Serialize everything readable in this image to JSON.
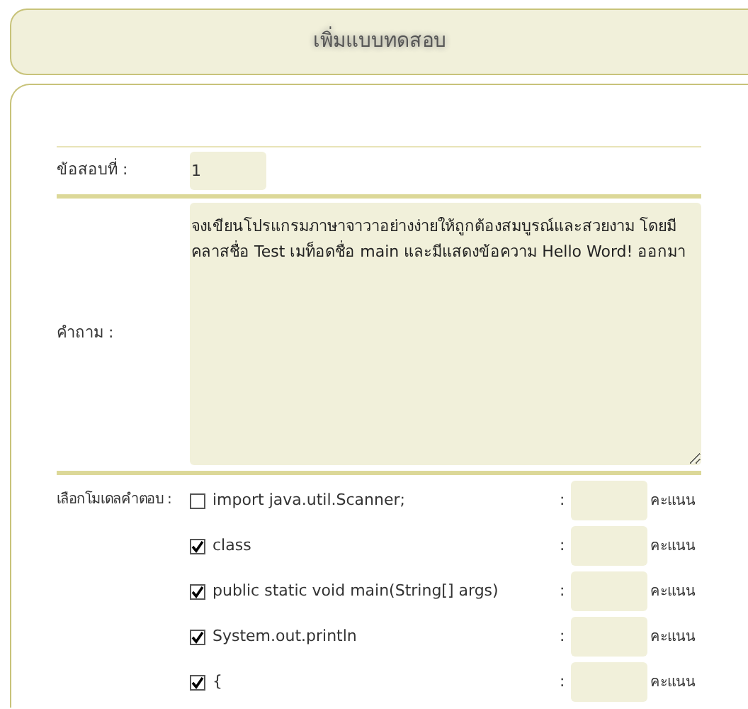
{
  "header": {
    "title": "เพิ่มแบบทดสอบ"
  },
  "question_number": {
    "label": "ข้อสอบที่ :",
    "value": "1"
  },
  "question": {
    "label": "คำถาม :",
    "value": "จงเขียนโปรแกรมภาษาจาวาอย่างง่ายให้ถูกต้องสมบูรณ์และสวยงาม โดยมีคลาสชื่อ Test เมท็อดชื่อ main และมีแสดงข้อความ Hello Word! ออกมา"
  },
  "answer_models": {
    "label": "เลือกโมเดลคำตอบ :",
    "items": [
      {
        "text": "import java.util.Scanner;",
        "checked": false,
        "separator": ":",
        "unit": "คะแนน"
      },
      {
        "text": "class",
        "checked": true,
        "separator": ":",
        "unit": "คะแนน"
      },
      {
        "text": "public static void main(String[] args)",
        "checked": true,
        "separator": ":",
        "unit": "คะแนน"
      },
      {
        "text": "System.out.println",
        "checked": true,
        "separator": ":",
        "unit": "คะแนน"
      },
      {
        "text": "{",
        "checked": true,
        "separator": ":",
        "unit": "คะแนน"
      }
    ]
  }
}
